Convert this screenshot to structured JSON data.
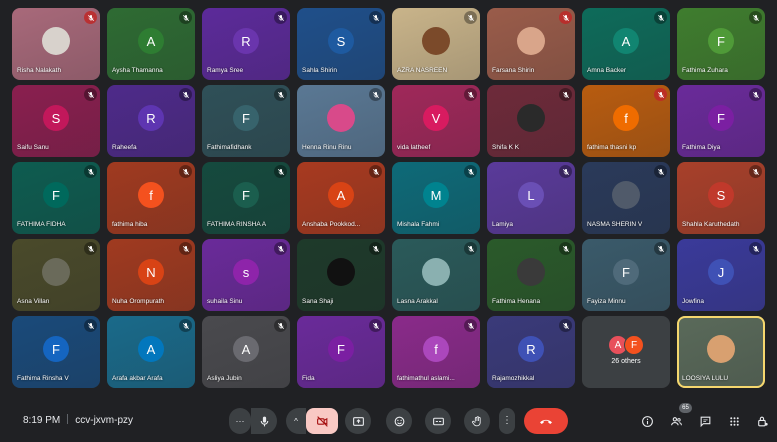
{
  "meeting": {
    "time": "8:19 PM",
    "code": "ccv-jxvm-pzy"
  },
  "people_count": "65",
  "others": {
    "label": "26 others",
    "initials": [
      "A",
      "F"
    ],
    "colors": [
      "#e8505b",
      "#f4511e"
    ]
  },
  "participants": [
    {
      "name": "Risha Nalakath",
      "initial": "",
      "bg": "#a8697a",
      "avatar": "#d8d2cc",
      "mute": "red"
    },
    {
      "name": "Aysha Thamanna",
      "initial": "A",
      "bg": "#2e6b33",
      "avatar": "#2e7d32",
      "mute": "dark"
    },
    {
      "name": "Ramya Sree",
      "initial": "R",
      "bg": "#5c2a9a",
      "avatar": "#6a35ad",
      "mute": "dark"
    },
    {
      "name": "Sahla Shirin",
      "initial": "S",
      "bg": "#1f4f8a",
      "avatar": "#1e5aa0",
      "mute": "dark"
    },
    {
      "name": "AZRA NASREEN",
      "initial": "",
      "bg": "#c9b48a",
      "avatar": "#7b4a2a",
      "mute": "dark"
    },
    {
      "name": "Farsana Shirin",
      "initial": "",
      "bg": "#9a5c4a",
      "avatar": "#d9a58a",
      "mute": "red"
    },
    {
      "name": "Amna Backer",
      "initial": "A",
      "bg": "#0e6b5a",
      "avatar": "#118571",
      "mute": "dark"
    },
    {
      "name": "Fathima Zuhara",
      "initial": "F",
      "bg": "#3f7d2e",
      "avatar": "#4f9a38",
      "mute": "dark"
    },
    {
      "name": "Saifu Sanu",
      "initial": "S",
      "bg": "#8a1f4f",
      "avatar": "#c2185b",
      "mute": "dark"
    },
    {
      "name": "Raheefa",
      "initial": "R",
      "bg": "#4e2a8a",
      "avatar": "#5e35b1",
      "mute": "dark"
    },
    {
      "name": "Fathimafidhank",
      "initial": "F",
      "bg": "#2f5058",
      "avatar": "#37636c",
      "mute": "dark"
    },
    {
      "name": "Henna Rinu Rinu",
      "initial": "",
      "bg": "#5a7894",
      "avatar": "#d84a8a",
      "mute": "dark"
    },
    {
      "name": "vida latheef",
      "initial": "V",
      "bg": "#a0285a",
      "avatar": "#d81b60",
      "mute": "dark"
    },
    {
      "name": "Shifa K K",
      "initial": "",
      "bg": "#6e2a3a",
      "avatar": "#2a2a2a",
      "mute": "dark"
    },
    {
      "name": "fathima thasni kp",
      "initial": "f",
      "bg": "#b85c10",
      "avatar": "#ef6c00",
      "mute": "red"
    },
    {
      "name": "Fathima Diya",
      "initial": "F",
      "bg": "#6a2a9a",
      "avatar": "#7b1fa2",
      "mute": "dark"
    },
    {
      "name": "FATHIMA FIDHA",
      "initial": "F",
      "bg": "#0e5c50",
      "avatar": "#00695c",
      "mute": "dark"
    },
    {
      "name": "fathima hiba",
      "initial": "f",
      "bg": "#a03a20",
      "avatar": "#f4511e",
      "mute": "dark"
    },
    {
      "name": "FATHIMA RINSHA A",
      "initial": "F",
      "bg": "#154a3e",
      "avatar": "#1b5e4e",
      "mute": "dark"
    },
    {
      "name": "Anshaba Pookkod...",
      "initial": "A",
      "bg": "#a83a20",
      "avatar": "#d84315",
      "mute": "dark"
    },
    {
      "name": "Mishala Fahmi",
      "initial": "M",
      "bg": "#0e6a78",
      "avatar": "#00838f",
      "mute": "dark"
    },
    {
      "name": "Lamiya",
      "initial": "L",
      "bg": "#5a3a9a",
      "avatar": "#6a4fb5",
      "mute": "dark"
    },
    {
      "name": "NASMA SHERIN V",
      "initial": "",
      "bg": "#2a3a5a",
      "avatar": "#505a6a",
      "mute": "dark"
    },
    {
      "name": "Shahla Karuthedath",
      "initial": "S",
      "bg": "#a8402a",
      "avatar": "#c0392b",
      "mute": "dark"
    },
    {
      "name": "Asna Villan",
      "initial": "",
      "bg": "#4a4a2a",
      "avatar": "#6a6a5a",
      "mute": "dark"
    },
    {
      "name": "Nuha Orompurath",
      "initial": "N",
      "bg": "#a03a20",
      "avatar": "#d84315",
      "mute": "dark"
    },
    {
      "name": "suhaila Sinu",
      "initial": "s",
      "bg": "#6a2a9a",
      "avatar": "#8e24aa",
      "mute": "dark"
    },
    {
      "name": "Sana Shaji",
      "initial": "",
      "bg": "#1e3a2a",
      "avatar": "#111111",
      "mute": "dark"
    },
    {
      "name": "Lasna Arakkal",
      "initial": "",
      "bg": "#2a5a5a",
      "avatar": "#8ab0b0",
      "mute": "dark"
    },
    {
      "name": "Fathima Henana",
      "initial": "",
      "bg": "#2a5a2a",
      "avatar": "#3a3a3a",
      "mute": "dark"
    },
    {
      "name": "Fayiza Minnu",
      "initial": "F",
      "bg": "#3a5a6a",
      "avatar": "#4f6a7a",
      "mute": "dark"
    },
    {
      "name": "Jowfina",
      "initial": "J",
      "bg": "#3a3a9a",
      "avatar": "#3f51b5",
      "mute": "dark"
    },
    {
      "name": "Fathima Rinsha V",
      "initial": "F",
      "bg": "#1a4a7a",
      "avatar": "#1565c0",
      "mute": "dark"
    },
    {
      "name": "Arafa akbar Arafa",
      "initial": "A",
      "bg": "#1a6a8a",
      "avatar": "#0277bd",
      "mute": "dark"
    },
    {
      "name": "Asliya Jubin",
      "initial": "A",
      "bg": "#4a4a4e",
      "avatar": "#6a6a70",
      "mute": "dark"
    },
    {
      "name": "Fida",
      "initial": "F",
      "bg": "#6a2a9a",
      "avatar": "#7b1fa2",
      "mute": "dark"
    },
    {
      "name": "fathimathul aslami...",
      "initial": "f",
      "bg": "#8a2a8a",
      "avatar": "#ab47bc",
      "mute": "dark"
    },
    {
      "name": "Rajamozhikkal",
      "initial": "R",
      "bg": "#3a3a7a",
      "avatar": "#3f51b5",
      "mute": "dark"
    },
    {
      "name": "LOOSIYA LULU",
      "initial": "",
      "bg": "#5a6a5a",
      "avatar": "#d8a070",
      "mute": "none",
      "speaking": true
    }
  ]
}
